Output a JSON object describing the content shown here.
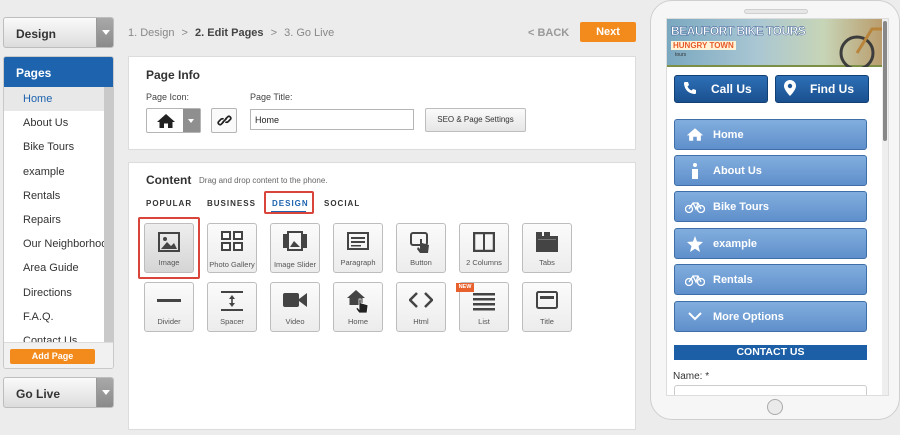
{
  "sidebar": {
    "mode_dropdown": "Design",
    "pages_header": "Pages",
    "pages": [
      "Home",
      "About Us",
      "Bike Tours",
      "example",
      "Rentals",
      "Repairs",
      "Our Neighborhood",
      "Area Guide",
      "Directions",
      "F.A.Q.",
      "Contact Us"
    ],
    "active_page": "Home",
    "add_page": "Add Page",
    "golive_dropdown": "Go Live"
  },
  "breadcrumb": {
    "step1": "1. Design",
    "sep1": ">",
    "step2": "2. Edit Pages",
    "sep2": ">",
    "step3": "3. Go Live"
  },
  "nav": {
    "back": "< BACK",
    "next": "Next"
  },
  "page_info": {
    "title": "Page Info",
    "icon_label": "Page Icon:",
    "title_label": "Page Title:",
    "title_value": "Home",
    "seo_button": "SEO & Page Settings",
    "selected_icon": "home-icon"
  },
  "content": {
    "title": "Content",
    "hint": "Drag and drop content to the phone.",
    "tabs": [
      "POPULAR",
      "BUSINESS",
      "DESIGN",
      "SOCIAL"
    ],
    "selected_tab": "DESIGN",
    "widgets": [
      {
        "label": "Image",
        "icon": "image-icon"
      },
      {
        "label": "Photo Gallery",
        "icon": "photo-gallery-icon"
      },
      {
        "label": "Image Slider",
        "icon": "image-slider-icon"
      },
      {
        "label": "Paragraph",
        "icon": "paragraph-icon"
      },
      {
        "label": "Button",
        "icon": "button-icon"
      },
      {
        "label": "2 Columns",
        "icon": "two-columns-icon"
      },
      {
        "label": "Tabs",
        "icon": "tabs-icon"
      },
      {
        "label": "Divider",
        "icon": "divider-icon"
      },
      {
        "label": "Spacer",
        "icon": "spacer-icon"
      },
      {
        "label": "Video",
        "icon": "video-icon"
      },
      {
        "label": "Home",
        "icon": "home-widget-icon"
      },
      {
        "label": "Html",
        "icon": "html-icon"
      },
      {
        "label": "List",
        "icon": "list-icon",
        "badge": "NEW"
      },
      {
        "label": "Title",
        "icon": "title-icon"
      }
    ],
    "selected_widget": "Image"
  },
  "phone": {
    "banner_title": "BEAUFORT BIKE TOURS",
    "banner_subtitle": "HUNGRY TOWN",
    "banner_tagline": "tours",
    "call_us": "Call Us",
    "find_us": "Find Us",
    "menu": [
      {
        "label": "Home",
        "icon": "home-icon"
      },
      {
        "label": "About Us",
        "icon": "info-icon"
      },
      {
        "label": "Bike Tours",
        "icon": "bicycle-icon"
      },
      {
        "label": "example",
        "icon": "star-icon"
      },
      {
        "label": "Rentals",
        "icon": "bicycle-icon"
      },
      {
        "label": "More Options",
        "icon": "chevron-down-icon"
      }
    ],
    "contact_header": "CONTACT US",
    "name_label": "Name:  *"
  },
  "colors": {
    "accent_orange": "#f28a1c",
    "brand_blue": "#1d63ae",
    "selection_red": "#d9443b"
  }
}
